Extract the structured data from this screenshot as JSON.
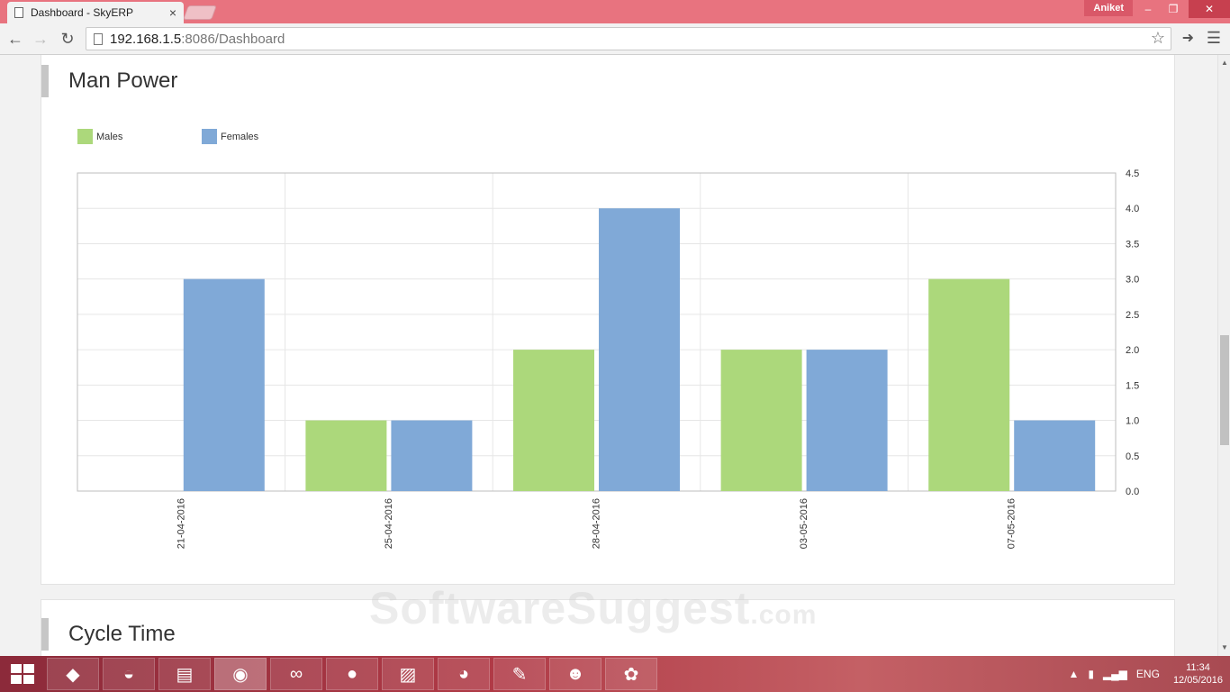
{
  "browser": {
    "tab_title": "Dashboard - SkyERP",
    "tab_close": "×",
    "profile_name": "Aniket",
    "url_host": "192.168.1.5",
    "url_path": ":8086/Dashboard"
  },
  "panels": {
    "manpower_title": "Man Power",
    "cycle_title": "Cycle Time"
  },
  "legend": {
    "males": "Males",
    "females": "Females"
  },
  "colors": {
    "males": "#acd87b",
    "females": "#80a9d7"
  },
  "chart_data": {
    "type": "bar",
    "title": "Man Power",
    "categories": [
      "21-04-2016",
      "25-04-2016",
      "28-04-2016",
      "03-05-2016",
      "07-05-2016"
    ],
    "series": [
      {
        "name": "Males",
        "values": [
          0,
          1,
          2,
          2,
          3
        ]
      },
      {
        "name": "Females",
        "values": [
          3,
          1,
          4,
          2,
          1
        ]
      }
    ],
    "y_ticks": [
      "0.0",
      "0.5",
      "1.0",
      "1.5",
      "2.0",
      "2.5",
      "3.0",
      "3.5",
      "4.0",
      "4.5"
    ],
    "ylim": [
      0,
      4.5
    ],
    "y_axis_side": "right",
    "grid": true,
    "legend_position": "top-left"
  },
  "watermark": {
    "text": "SoftwareSuggest",
    "suffix": ".com"
  },
  "taskbar": {
    "apps": [
      {
        "name": "Visual Studio",
        "glyph": "◆"
      },
      {
        "name": "MySQL",
        "glyph": "◒"
      },
      {
        "name": "File Explorer",
        "glyph": "▤"
      },
      {
        "name": "Chrome",
        "glyph": "◉"
      },
      {
        "name": "Infinity app",
        "glyph": "∞"
      },
      {
        "name": "Firefox",
        "glyph": "●"
      },
      {
        "name": "Sticky Notes",
        "glyph": "▨"
      },
      {
        "name": "Hamster app",
        "glyph": "◕"
      },
      {
        "name": "Notepad++",
        "glyph": "✎"
      },
      {
        "name": "People app",
        "glyph": "☻"
      },
      {
        "name": "Paint",
        "glyph": "✿"
      }
    ],
    "language": "ENG",
    "time": "11:34",
    "date": "12/05/2016"
  }
}
